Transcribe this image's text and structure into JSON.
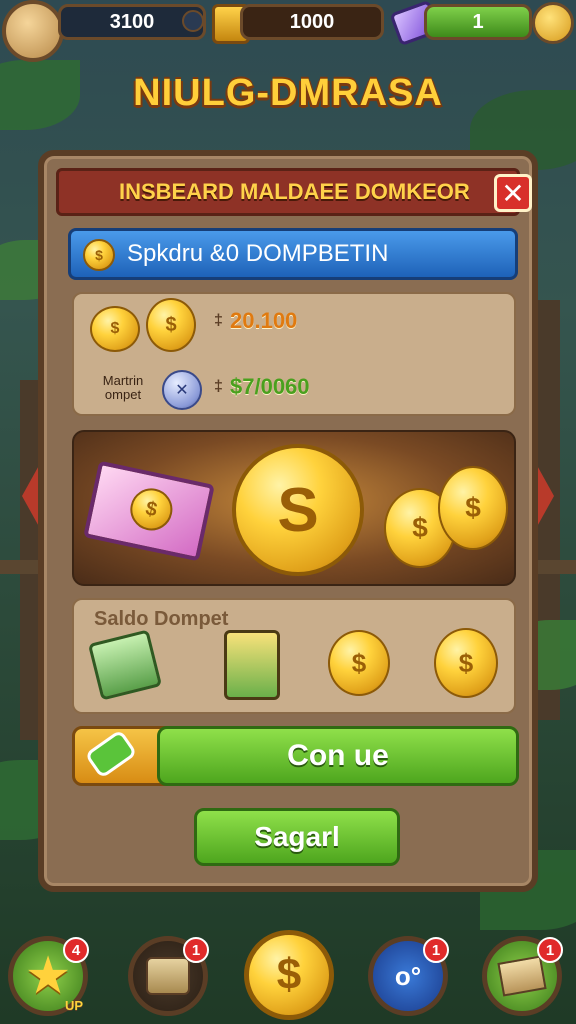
{
  "topbar": {
    "gems_value": "3100",
    "gold_value": "1000",
    "energy_value": "1"
  },
  "game_title": "NIULG-DMRASA",
  "panel": {
    "header_title": "INSBEARD MALDAEE DOMKEOR",
    "close_label": "✕",
    "info_bar_label": "Spkdru &0 DOMPBETIN",
    "reward_rows": [
      {
        "label": "",
        "amount": "20.100",
        "prefix": "‡"
      },
      {
        "label": "Martrin\nompet",
        "amount": "$7/0060",
        "prefix": "‡"
      }
    ],
    "shop_section_title": "Saldo Dompet",
    "continue_label": "Con ue",
    "secondary_label": "Sagarl"
  },
  "bottom_nav": [
    {
      "name": "star",
      "badge": "4",
      "sub": "UP"
    },
    {
      "name": "bag",
      "badge": "1"
    },
    {
      "name": "coin",
      "badge": ""
    },
    {
      "name": "chat",
      "badge": "1"
    },
    {
      "name": "box",
      "badge": "1"
    }
  ],
  "colors": {
    "accent_gold": "#ffcf3a",
    "header_red": "#8e3226",
    "info_blue": "#1e62b8",
    "button_green": "#4ea61e"
  }
}
